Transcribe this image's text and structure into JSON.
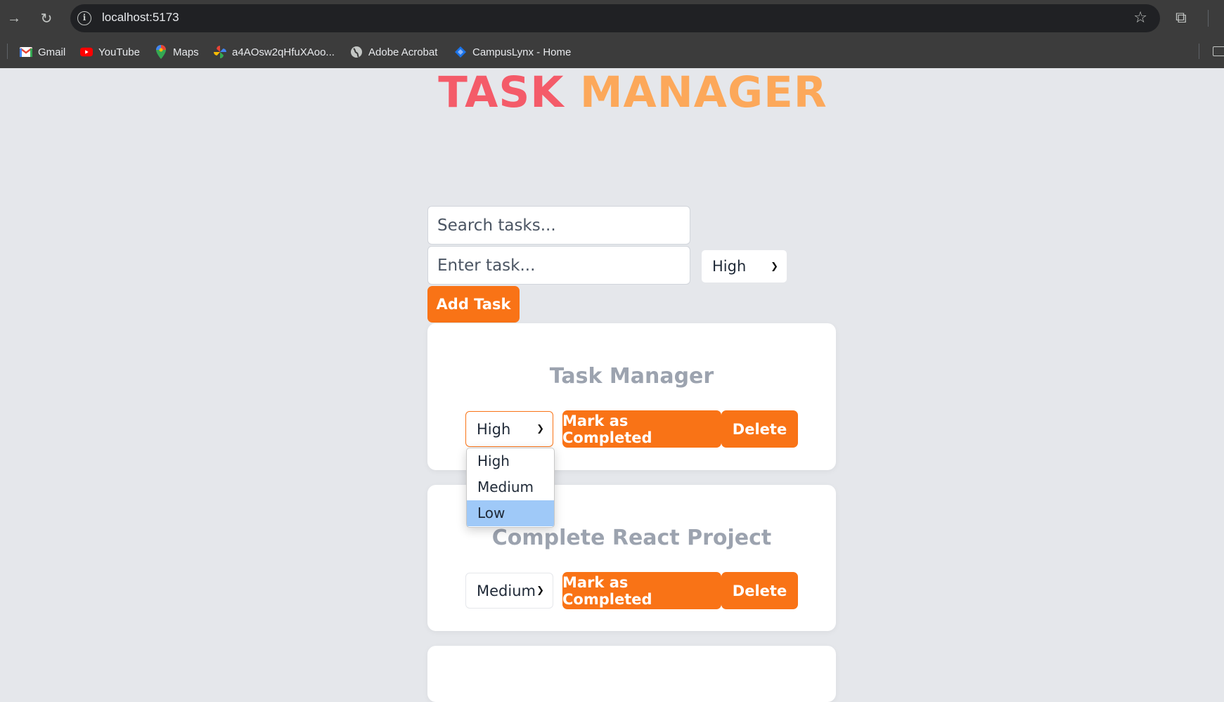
{
  "browser": {
    "url": "localhost:5173",
    "bookmarks": [
      {
        "label": "Gmail",
        "icon": "gmail-icon"
      },
      {
        "label": "YouTube",
        "icon": "youtube-icon"
      },
      {
        "label": "Maps",
        "icon": "maps-icon"
      },
      {
        "label": "a4AOsw2qHfuXAoo...",
        "icon": "pinwheel-icon"
      },
      {
        "label": "Adobe Acrobat",
        "icon": "globe-icon"
      },
      {
        "label": "CampusLynx - Home",
        "icon": "campuslynx-icon"
      }
    ]
  },
  "app": {
    "title_part1": "TASK",
    "title_part2": "MANAGER",
    "search_placeholder": "Search tasks...",
    "task_placeholder": "Enter task...",
    "priority_value": "High",
    "add_button": "Add Task"
  },
  "tasks": [
    {
      "title": "Task Manager",
      "priority": "High",
      "complete_label": "Mark as Completed",
      "delete_label": "Delete"
    },
    {
      "title": "Complete React Project",
      "priority": "Medium",
      "complete_label": "Mark as Completed",
      "delete_label": "Delete"
    }
  ],
  "dropdown": {
    "options": [
      "High",
      "Medium",
      "Low"
    ],
    "highlighted": "Low"
  },
  "colors": {
    "accent": "#f97316",
    "title_red": "#f45b69",
    "title_orange": "#fca85a",
    "page_bg": "#e5e7eb"
  }
}
